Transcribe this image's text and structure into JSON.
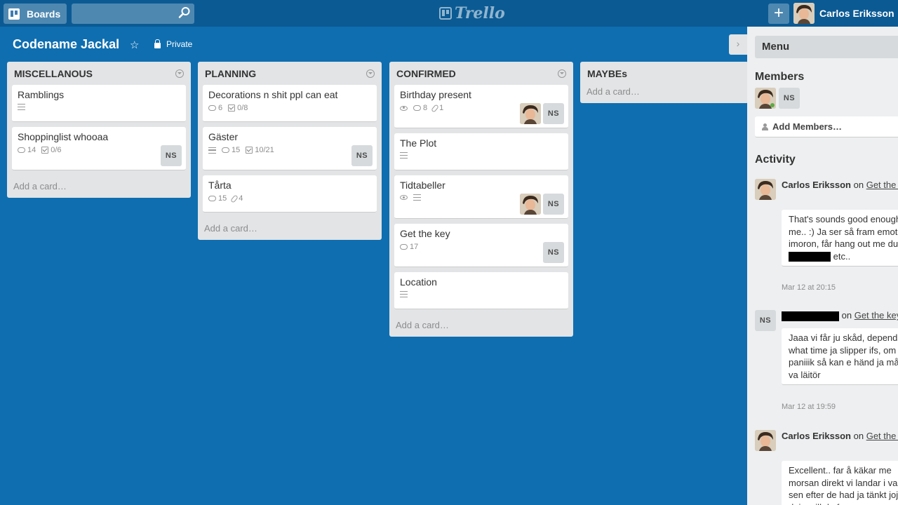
{
  "header": {
    "boards_label": "Boards",
    "logo_text": "Trello",
    "add_label": "+",
    "user_name": "Carlos Eriksson"
  },
  "board": {
    "title": "Codename Jackal",
    "visibility": "Private"
  },
  "lists": [
    {
      "title": "MISCELLANOUS",
      "add_card": "Add a card…",
      "cards": [
        {
          "title": "Ramblings",
          "badges": {
            "desc": true
          }
        },
        {
          "title": "Shoppinglist whooaa",
          "badges": {
            "comments": "14",
            "checklist": "0/6"
          },
          "members": [
            "NS"
          ]
        }
      ]
    },
    {
      "title": "PLANNING",
      "add_card": "Add a card…",
      "cards": [
        {
          "title": "Decorations n shit ppl can eat",
          "badges": {
            "comments": "6",
            "checklist": "0/8"
          }
        },
        {
          "title": "Gäster",
          "badges": {
            "desc": true,
            "comments": "15",
            "checklist": "10/21"
          },
          "members": [
            "NS"
          ]
        },
        {
          "title": "Tårta",
          "badges": {
            "comments": "15",
            "attachments": "4"
          }
        }
      ]
    },
    {
      "title": "CONFIRMED",
      "add_card": "Add a card…",
      "cards": [
        {
          "title": "Birthday present",
          "badges": {
            "watch": true,
            "comments": "8",
            "attachments": "1"
          },
          "members": [
            "avatar",
            "NS"
          ]
        },
        {
          "title": "The Plot",
          "badges": {
            "desc": true
          }
        },
        {
          "title": "Tidtabeller",
          "badges": {
            "watch": true,
            "desc": true
          },
          "members": [
            "avatar",
            "NS"
          ]
        },
        {
          "title": "Get the key",
          "badges": {
            "comments": "17"
          },
          "members": [
            "NS"
          ]
        },
        {
          "title": "Location",
          "badges": {
            "desc": true
          }
        }
      ]
    },
    {
      "title": "MAYBEs",
      "add_card": "Add a card…",
      "cards": []
    }
  ],
  "panel": {
    "menu_title": "Menu",
    "members_title": "Members",
    "member_initials": "NS",
    "add_members": "Add Members…",
    "activity_title": "Activity",
    "activities": [
      {
        "author": "Carlos Eriksson",
        "on": "on",
        "card": "Get the key",
        "comment_before": "That's sounds good enough to me.. :) Ja ser så fram emot imoron, får hang out me du,",
        "comment_after": "etc..",
        "date": "Mar 12 at 20:15"
      },
      {
        "author_initials": "NS",
        "on": "on",
        "card": "Get the key",
        "comment": "Jaaa vi får ju skåd, depends what time ja slipper ifs, om e ji paniiik så kan e händ ja måst va läitör",
        "date": "Mar 12 at 19:59"
      },
      {
        "author": "Carlos Eriksson",
        "on": "on",
        "card": "Get the key",
        "comment": "Excellent.. far å käkar me morsan direkt vi landar i vasa å sen efter de had ja tänkt joja dej... vill du far"
      }
    ]
  }
}
